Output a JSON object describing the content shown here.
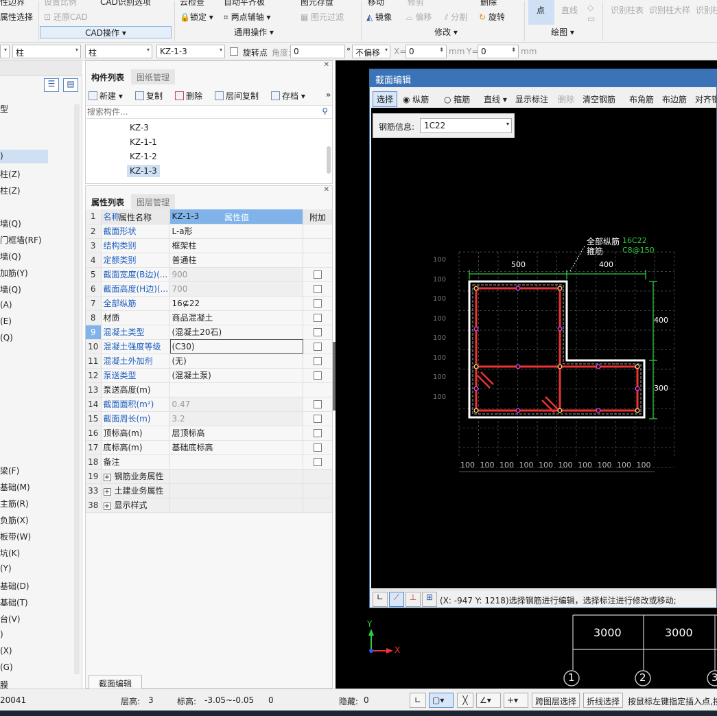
{
  "ribbon": {
    "row1": {
      "edge_select": "性边界",
      "restore_scale": "设置比例",
      "cad_options": "CAD识别选项",
      "cloud_check": "云检查",
      "auto_slab": "自动平齐板",
      "layer_save": "图元存盘",
      "move": "移动",
      "trim": "修剪",
      "delete": "删除"
    },
    "row2": {
      "attr_select": "属性选择",
      "restore_cad": "还原CAD",
      "lock": "锁定",
      "two_point_axis": "两点辅轴",
      "filter": "图元过滤",
      "mirror": "镜像",
      "offset": "偏移",
      "split": "分割",
      "rotate": "旋转",
      "point": "点",
      "line": "直线",
      "identify_table": "识别柱表",
      "identify_detail": "识别柱大样",
      "identify_col": "识别柱"
    },
    "groups": {
      "cad_ops": "CAD操作",
      "general_ops": "通用操作",
      "modify": "修改",
      "draw": "绘图"
    }
  },
  "toolbar2": {
    "combo1": "柱",
    "combo2": "柱",
    "combo3": "KZ-1-3",
    "rotate_point": "旋转点",
    "angle_label": "角度:",
    "angle_value": "0",
    "degree": "°",
    "offset_combo": "不偏移",
    "x_label": "X=",
    "x_value": "0",
    "y_label": "Y=",
    "y_value": "0",
    "unit_mm": "mm"
  },
  "left_strip": {
    "items": [
      {
        "label": "型"
      },
      {
        "label": ")"
      },
      {
        "label": "柱(Z)"
      },
      {
        "label": "柱(Z)"
      },
      {
        "label": "墙(Q)"
      },
      {
        "label": "门框墙(RF)"
      },
      {
        "label": "墙(Q)"
      },
      {
        "label": "加筋(Y)"
      },
      {
        "label": "墙(Q)"
      },
      {
        "label": "(A)"
      },
      {
        "label": "(E)"
      },
      {
        "label": "(Q)"
      },
      {
        "label": "梁(F)"
      },
      {
        "label": "基础(M)"
      },
      {
        "label": "主筋(R)"
      },
      {
        "label": "负筋(X)"
      },
      {
        "label": "板带(W)"
      },
      {
        "label": "坑(K)"
      },
      {
        "label": "(Y)"
      },
      {
        "label": "基础(D)"
      },
      {
        "label": "基础(T)"
      },
      {
        "label": "台(V)"
      },
      {
        "label": ")"
      },
      {
        "label": "(X)"
      },
      {
        "label": "(G)"
      },
      {
        "label": "膜"
      }
    ]
  },
  "component_panel": {
    "tab_active": "构件列表",
    "tab_inactive": "图纸管理",
    "new": "新建",
    "copy": "复制",
    "delete": "删除",
    "floor_copy": "层间复制",
    "archive": "存档",
    "search_placeholder": "搜索构件...",
    "items": [
      "KZ-3",
      "KZ-1-1",
      "KZ-1-2",
      "KZ-1-3"
    ]
  },
  "property_panel": {
    "tab_active": "属性列表",
    "tab_inactive": "图层管理",
    "header_name": "属性名称",
    "header_value": "属性值",
    "header_add": "附加",
    "rows": [
      {
        "num": "1",
        "name": "名称",
        "value": "KZ-1-3"
      },
      {
        "num": "2",
        "name": "截面形状",
        "value": "L-a形"
      },
      {
        "num": "3",
        "name": "结构类别",
        "value": "框架柱"
      },
      {
        "num": "4",
        "name": "定额类别",
        "value": "普通柱"
      },
      {
        "num": "5",
        "name": "截面宽度(B边)(...",
        "value": "900"
      },
      {
        "num": "6",
        "name": "截面高度(H边)(...",
        "value": "700"
      },
      {
        "num": "7",
        "name": "全部纵筋",
        "value": "16⊈22"
      },
      {
        "num": "8",
        "name": "材质",
        "value": "商品混凝土"
      },
      {
        "num": "9",
        "name": "混凝土类型",
        "value": "(混凝土20石)"
      },
      {
        "num": "10",
        "name": "混凝土强度等级",
        "value": "(C30)"
      },
      {
        "num": "11",
        "name": "混凝土外加剂",
        "value": "(无)"
      },
      {
        "num": "12",
        "name": "泵送类型",
        "value": "(混凝土泵)"
      },
      {
        "num": "13",
        "name": "泵送高度(m)",
        "value": ""
      },
      {
        "num": "14",
        "name": "截面面积(m²)",
        "value": "0.47"
      },
      {
        "num": "15",
        "name": "截面周长(m)",
        "value": "3.2"
      },
      {
        "num": "16",
        "name": "顶标高(m)",
        "value": "层顶标高"
      },
      {
        "num": "17",
        "name": "底标高(m)",
        "value": "基础底标高"
      },
      {
        "num": "18",
        "name": "备注",
        "value": ""
      },
      {
        "num": "19",
        "name": "钢筋业务属性",
        "value": ""
      },
      {
        "num": "33",
        "name": "土建业务属性",
        "value": ""
      },
      {
        "num": "38",
        "name": "显示样式",
        "value": ""
      }
    ],
    "section_edit_button": "截面编辑"
  },
  "section_dialog": {
    "title": "截面编辑",
    "select": "选择",
    "radio_long": "纵筋",
    "radio_stirrup": "箍筋",
    "line": "直线",
    "show_annot": "显示标注",
    "delete": "删除",
    "clear": "清空钢筋",
    "corner": "布角筋",
    "edge": "布边筋",
    "align": "对齐钢",
    "rebar_info_label": "钢筋信息:",
    "rebar_info_value": "1C22",
    "all_long_label": "全部纵筋",
    "all_long_value": "16C22",
    "stirrup_label": "箍筋",
    "stirrup_value": "C8@150",
    "dim_top_left": "500",
    "dim_top_right": "400",
    "dim_right_top": "400",
    "dim_right_bottom": "300",
    "grid_label": "100",
    "status": "(X: -947 Y: 1218)选择钢筋进行编辑，选择标注进行修改或移动;"
  },
  "main_canvas": {
    "dim_a": "3000",
    "dim_b": "3000",
    "axis_1": "1",
    "axis_2": "2",
    "axis_3": "3",
    "axis_x": "X",
    "axis_y": "Y"
  },
  "status_bar": {
    "coord": "20041",
    "floor_label": "层高:",
    "floor_value": "3",
    "elev_label": "标高:",
    "elev_value": "-3.05~-0.05",
    "zero": "0",
    "hidden_label": "隐藏:",
    "hidden_value": "0",
    "cross_layer": "跨图层选择",
    "polyline_select": "折线选择",
    "hint": "按鼠标左键指定插入点,按"
  }
}
